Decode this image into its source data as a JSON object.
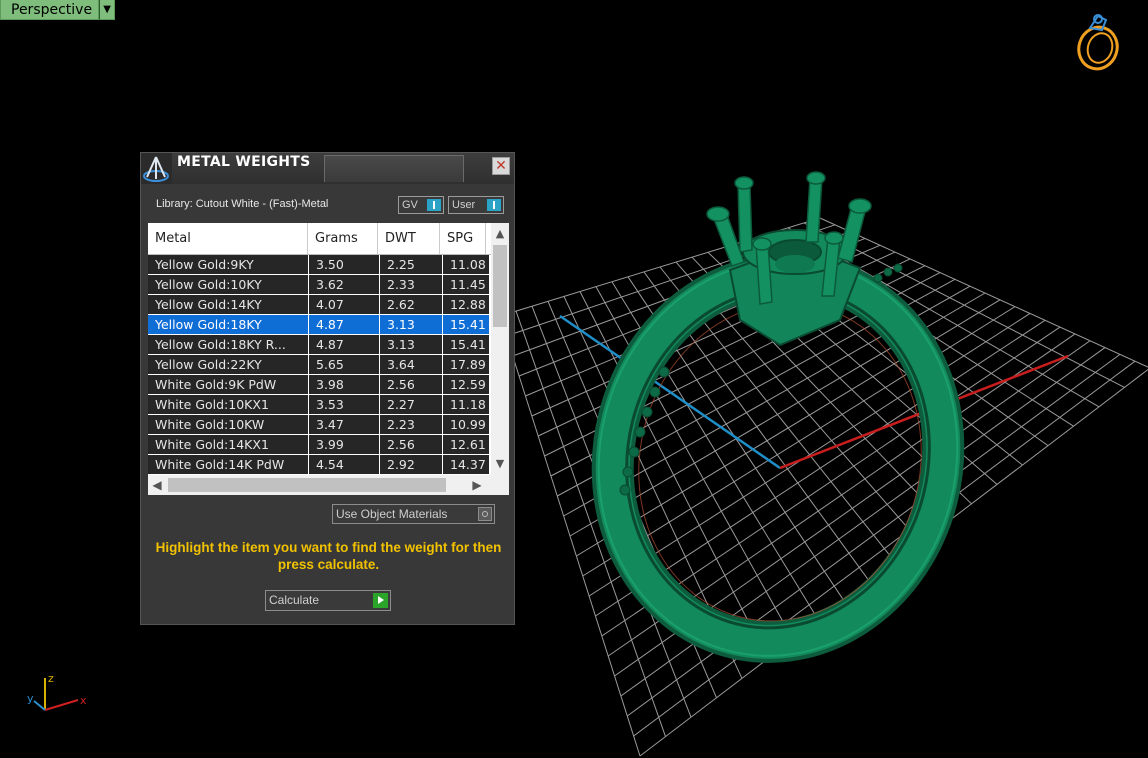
{
  "viewport": {
    "label": "Perspective",
    "dropdown_icon": "triangle-down-icon",
    "background": "#000000",
    "model_color": "#0f7a52",
    "axes": {
      "x": "x",
      "y": "y",
      "z": "z",
      "x_color": "#d02020",
      "y_color": "#2a8fd0",
      "z_color": "#d8b000"
    }
  },
  "dialog": {
    "title": "METAL WEIGHTS",
    "close_icon": "close-icon",
    "library_label": "Library: Cutout White - (Fast)-Metal",
    "gv_toggle": "GV",
    "user_toggle": "User",
    "table": {
      "columns": [
        "Metal",
        "Grams",
        "DWT",
        "SPG"
      ],
      "rows": [
        [
          "Yellow Gold:9KY",
          "3.50",
          "2.25",
          "11.08"
        ],
        [
          "Yellow Gold:10KY",
          "3.62",
          "2.33",
          "11.45"
        ],
        [
          "Yellow Gold:14KY",
          "4.07",
          "2.62",
          "12.88"
        ],
        [
          "Yellow Gold:18KY",
          "4.87",
          "3.13",
          "15.41"
        ],
        [
          "Yellow Gold:18KY R...",
          "4.87",
          "3.13",
          "15.41"
        ],
        [
          "Yellow Gold:22KY",
          "5.65",
          "3.64",
          "17.89"
        ],
        [
          "White Gold:9K PdW",
          "3.98",
          "2.56",
          "12.59"
        ],
        [
          "White Gold:10KX1",
          "3.53",
          "2.27",
          "11.18"
        ],
        [
          "White Gold:10KW",
          "3.47",
          "2.23",
          "10.99"
        ],
        [
          "White Gold:14KX1",
          "3.99",
          "2.56",
          "12.61"
        ],
        [
          "White Gold:14K PdW",
          "4.54",
          "2.92",
          "14.37"
        ]
      ],
      "selected_index": 3
    },
    "use_object_materials": "Use Object Materials",
    "hint": "Highlight the item you want to find the weight for then press calculate.",
    "calculate_label": "Calculate",
    "accent": "#f2c200",
    "selection_color": "#0f6dd6"
  }
}
